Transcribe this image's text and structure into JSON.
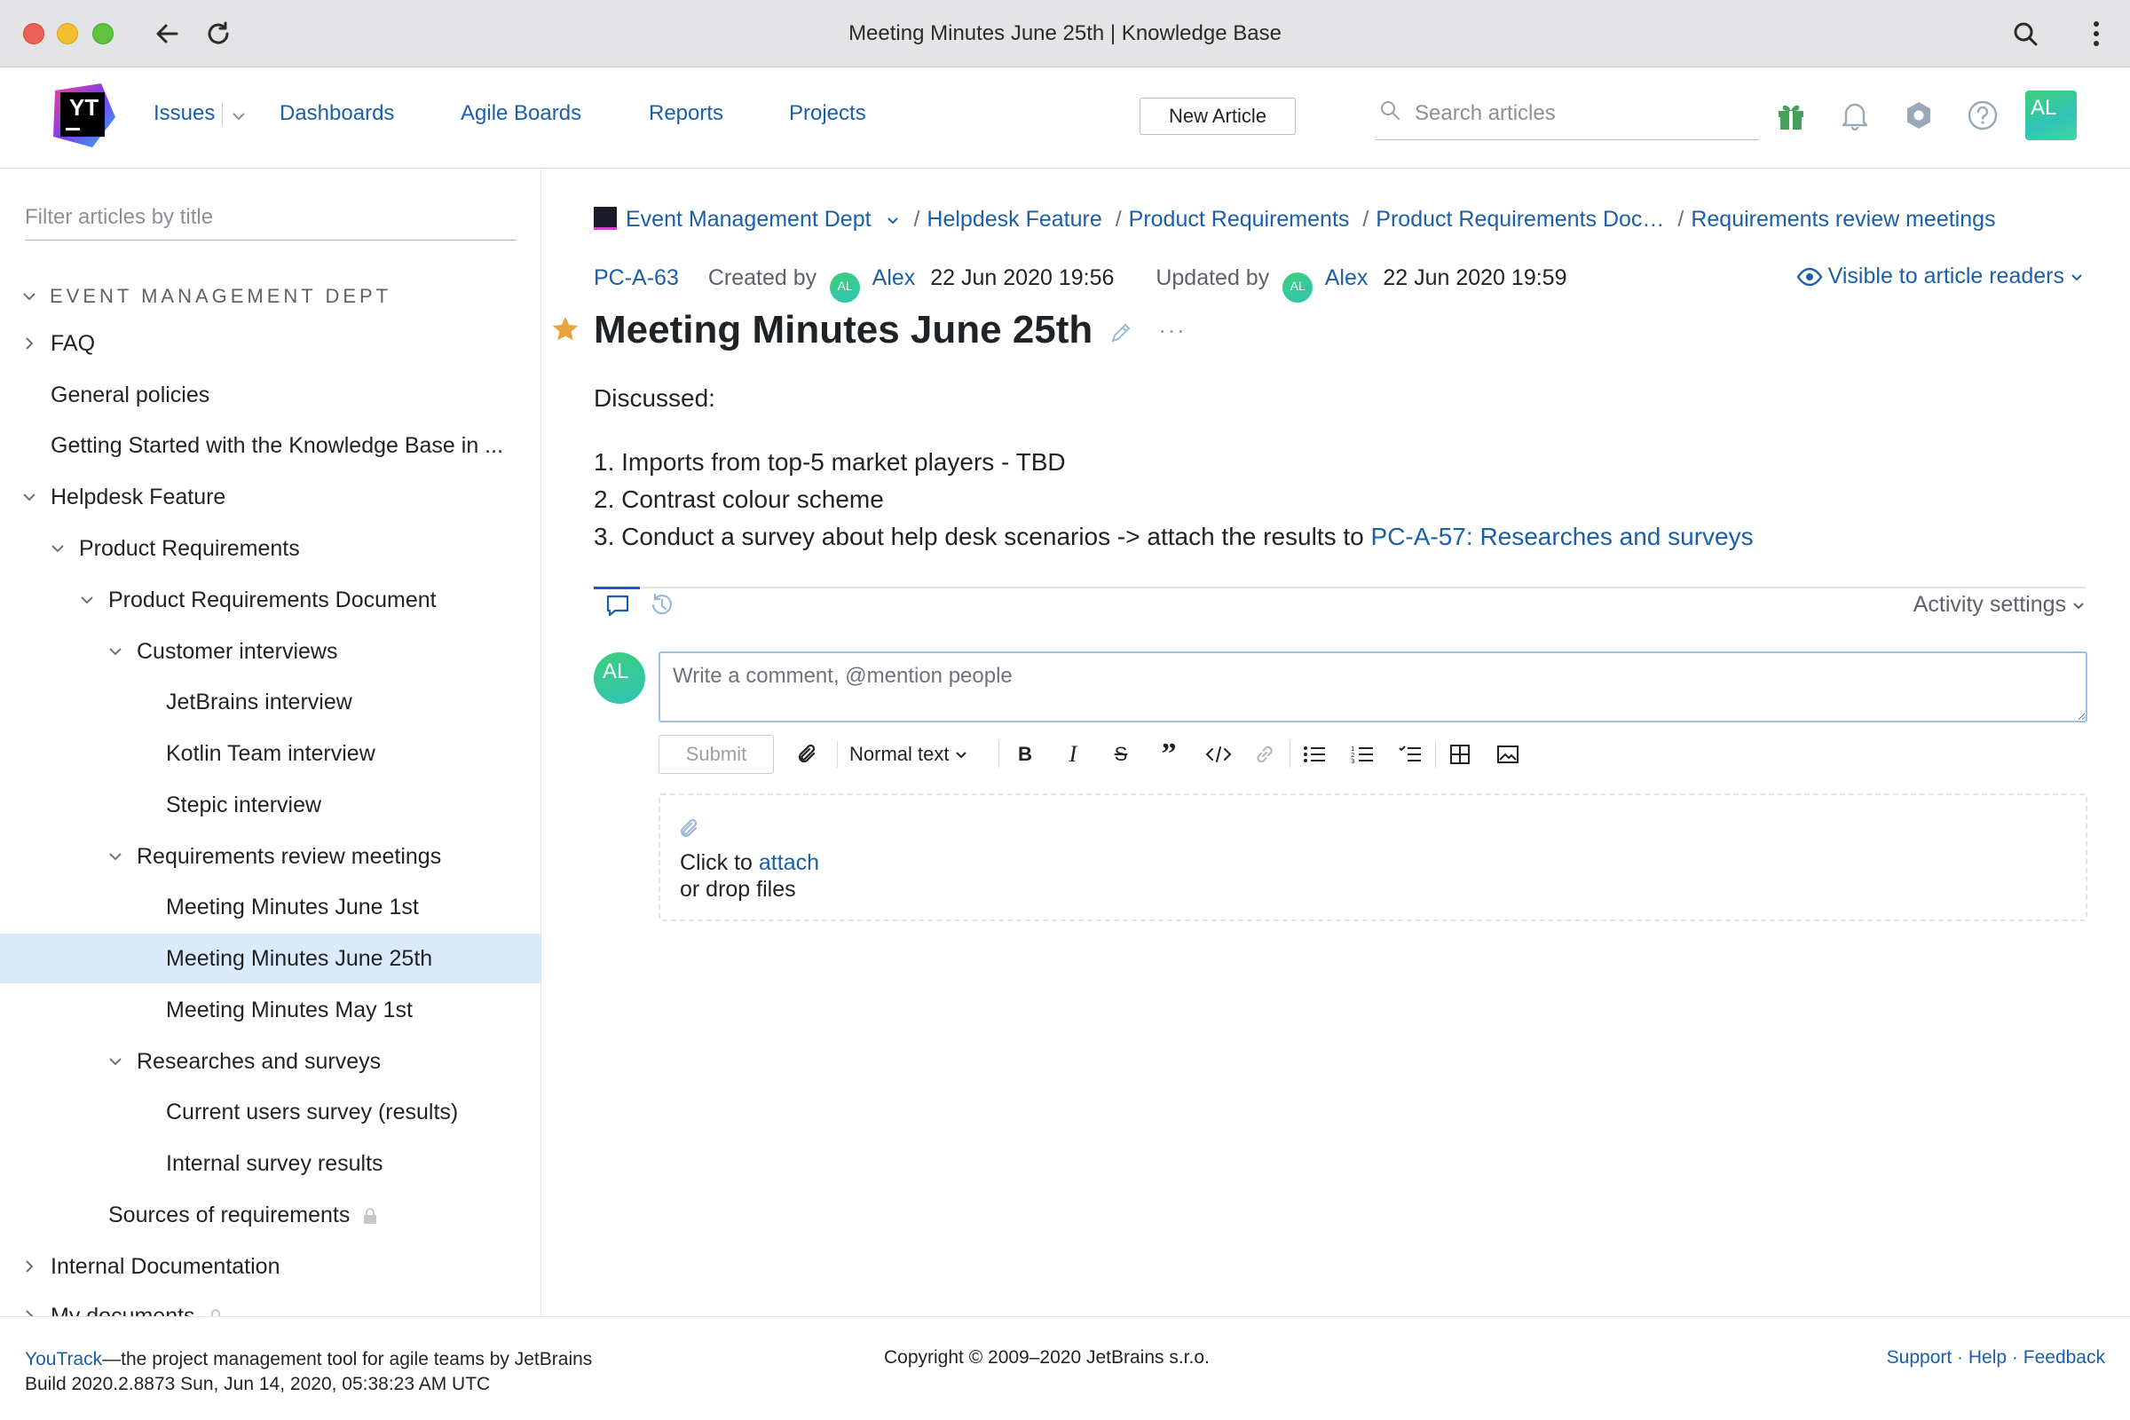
{
  "browser": {
    "title": "Meeting Minutes June 25th | Knowledge Base"
  },
  "header": {
    "logo_text": "YT",
    "nav": [
      "Issues",
      "Dashboards",
      "Agile Boards",
      "Reports",
      "Projects"
    ],
    "new_article": "New Article",
    "search_placeholder": "Search articles",
    "avatar_initials": "AL"
  },
  "sidebar": {
    "filter_placeholder": "Filter articles by title",
    "group_title": "EVENT MANAGEMENT DEPT",
    "items": [
      {
        "label": "FAQ"
      },
      {
        "label": "General policies"
      },
      {
        "label": "Getting Started with the Knowledge Base in ..."
      },
      {
        "label": "Helpdesk Feature"
      },
      {
        "label": "Product Requirements"
      },
      {
        "label": "Product Requirements Document"
      },
      {
        "label": "Customer interviews"
      },
      {
        "label": "JetBrains interview"
      },
      {
        "label": "Kotlin Team interview"
      },
      {
        "label": "Stepic interview"
      },
      {
        "label": "Requirements review meetings"
      },
      {
        "label": "Meeting Minutes June 1st"
      },
      {
        "label": "Meeting Minutes June 25th"
      },
      {
        "label": "Meeting Minutes May 1st"
      },
      {
        "label": "Researches and surveys"
      },
      {
        "label": "Current users survey (results)"
      },
      {
        "label": "Internal survey results"
      },
      {
        "label": "Sources of requirements"
      },
      {
        "label": "Internal Documentation"
      },
      {
        "label": "My documents"
      }
    ]
  },
  "article": {
    "breadcrumbs": [
      "Event Management Dept",
      "Helpdesk Feature",
      "Product Requirements",
      "Product Requirements Doc…",
      "Requirements review meetings"
    ],
    "id": "PC-A-63",
    "created_label": "Created by",
    "created_author": "Alex",
    "created_date": "22 Jun 2020 19:56",
    "updated_label": "Updated by",
    "updated_author": "Alex",
    "updated_date": "22 Jun 2020 19:59",
    "author_initials": "AL",
    "visibility": "Visible to article readers",
    "title": "Meeting Minutes June 25th",
    "intro": "Discussed:",
    "list": [
      "Imports from top-5 market players - TBD",
      "Contrast colour scheme",
      "Conduct a survey about help desk scenarios -> attach the results to "
    ],
    "list_numbers": [
      "1.",
      "2.",
      "3."
    ],
    "list_link": "PC-A-57: Researches and surveys"
  },
  "activity": {
    "settings_label": "Activity settings",
    "comment_placeholder": "Write a comment, @mention people",
    "submit": "Submit",
    "text_style": "Normal text",
    "attach_prefix": "Click to ",
    "attach_link": "attach",
    "attach_suffix": "or drop files"
  },
  "footer": {
    "brand": "YouTrack",
    "tagline": "—the project management tool for agile teams by JetBrains",
    "build": "Build 2020.2.8873 Sun, Jun 14, 2020, 05:38:23 AM UTC",
    "copyright": "Copyright © 2009–2020 JetBrains s.r.o.",
    "links": [
      "Support",
      "Help",
      "Feedback"
    ],
    "link_separator": " · "
  },
  "colors": {
    "link": "#1a5fa8",
    "selected": "#dbeafb",
    "accent_star": "#e8a33d"
  }
}
